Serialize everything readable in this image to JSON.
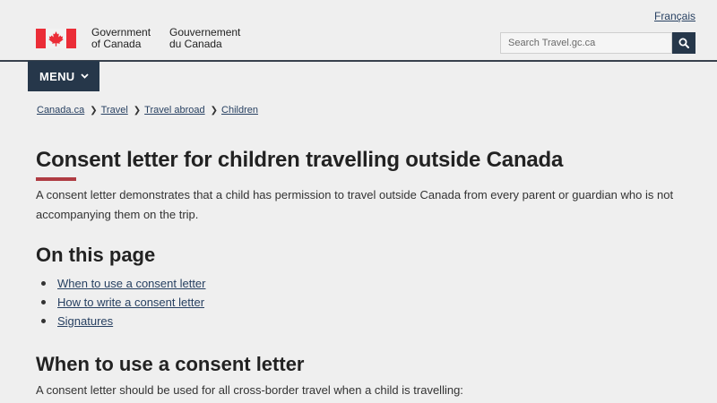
{
  "header": {
    "language_link": "Français",
    "signature_en_line1": "Government",
    "signature_en_line2": "of Canada",
    "signature_fr_line1": "Gouvernement",
    "signature_fr_line2": "du Canada",
    "search_placeholder": "Search Travel.gc.ca",
    "flag_color": "#eb2d37",
    "search_button_icon": "search-icon"
  },
  "nav": {
    "menu_label": "MENU",
    "menu_icon": "chevron-down-icon",
    "breadcrumbs": [
      "Canada.ca",
      "Travel",
      "Travel abroad",
      "Children"
    ]
  },
  "main": {
    "title": "Consent letter for children travelling outside Canada",
    "intro": "A consent letter demonstrates that a child has permission to travel outside Canada from every parent or guardian who is not accompanying them on the trip.",
    "on_this_page_heading": "On this page",
    "toc": [
      "When to use a consent letter",
      "How to write a consent letter",
      "Signatures"
    ],
    "section_heading": "When to use a consent letter",
    "section_text": "A consent letter should be used for all cross-border travel when a child is travelling:"
  },
  "colors": {
    "brand_dark": "#26374a",
    "link": "#284162",
    "accent_red": "#af3c43",
    "background": "#efefef"
  }
}
